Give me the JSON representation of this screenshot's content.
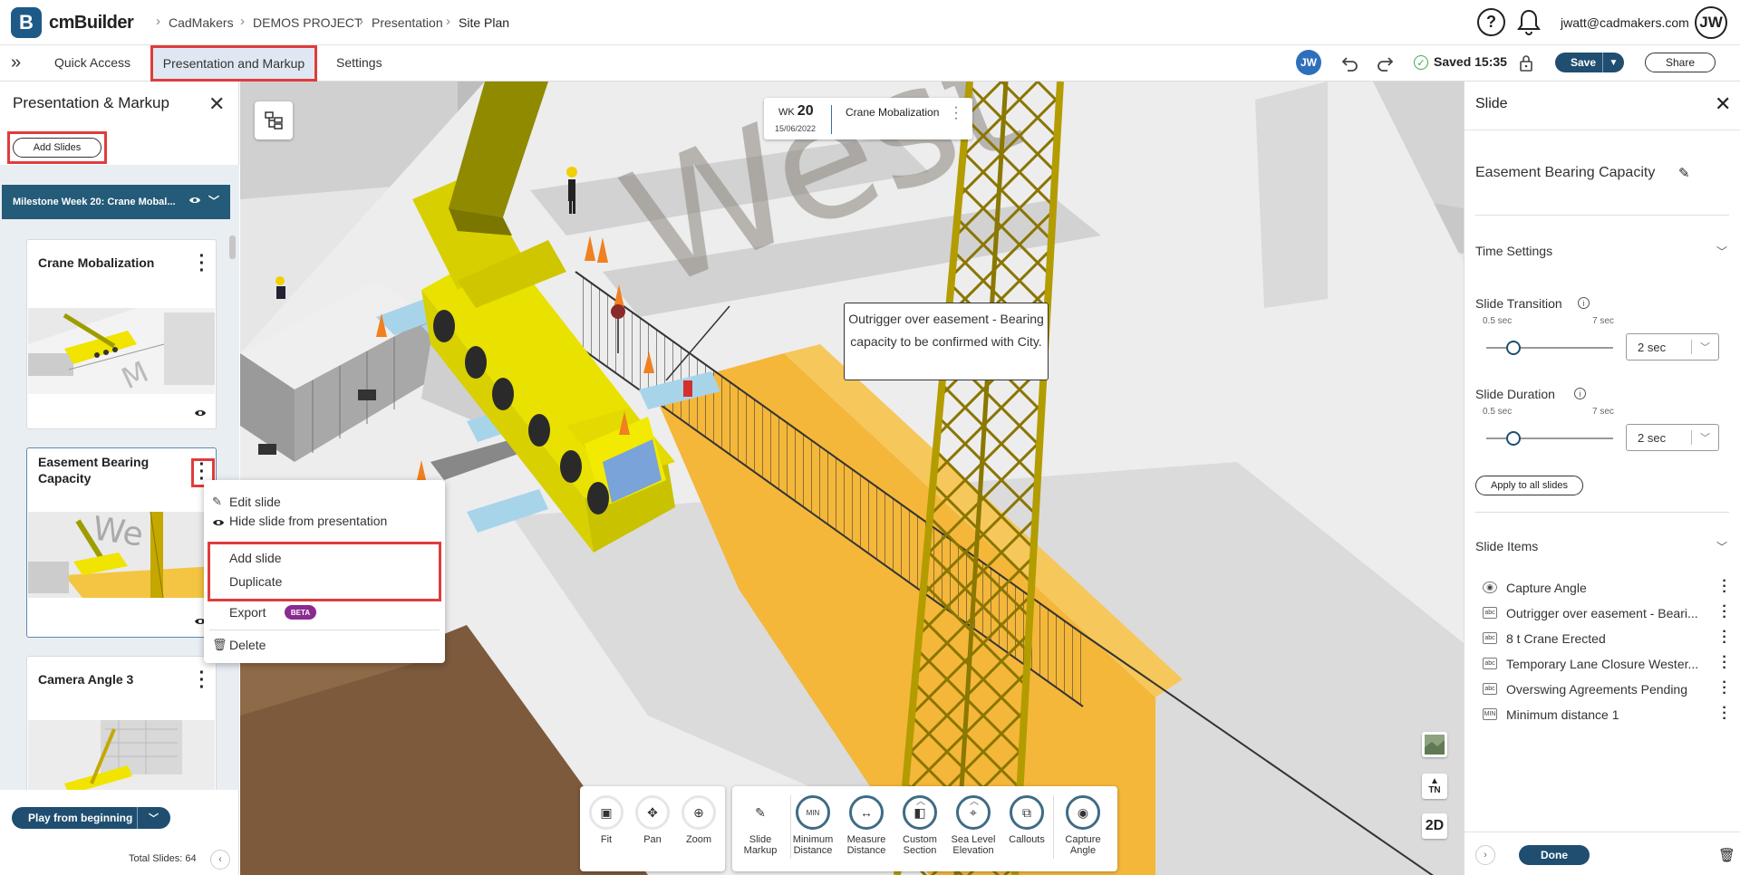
{
  "app": {
    "brand": "cmBuilder",
    "logo_letter": "B"
  },
  "breadcrumb": [
    "CadMakers",
    "DEMOS PROJECT",
    "Presentation",
    "Site Plan"
  ],
  "header": {
    "help_glyph": "?",
    "user_email": "jwatt@cadmakers.com",
    "avatar_initials": "JW"
  },
  "subnav": {
    "tabs": [
      "Quick Access",
      "Presentation and Markup",
      "Settings"
    ],
    "active_tab": "Presentation and Markup",
    "collaborator_initials": "JW",
    "saved_text": "Saved 15:35",
    "save_label": "Save",
    "share_label": "Share"
  },
  "left_panel": {
    "title": "Presentation & Markup",
    "add_slides_label": "Add Slides",
    "milestone_label": "Milestone Week 20: Crane Mobal...",
    "slides": [
      {
        "title": "Crane Mobalization"
      },
      {
        "title": "Easement Bearing Capacity"
      },
      {
        "title": "Camera Angle 3"
      }
    ],
    "play_label": "Play from beginning",
    "total_slides": "Total Slides: 64"
  },
  "context_menu": {
    "items": [
      "Edit slide",
      "Hide slide from presentation",
      "Add slide",
      "Duplicate",
      "Export",
      "Delete"
    ],
    "beta_label": "BETA"
  },
  "viewport": {
    "week_prefix": "WK",
    "week_number": "20",
    "date": "15/06/2022",
    "milestone_name": "Crane Mobalization",
    "callout_text": "Outrigger over easement - Bearing capacity to be confirmed with City.",
    "north_label": "TN",
    "view_mode_label": "2D"
  },
  "toolbar": {
    "nav_tools": [
      "Fit",
      "Pan",
      "Zoom"
    ],
    "markup_tools": [
      {
        "label": "Slide Markup",
        "icon": "pencil-icon"
      },
      {
        "label": "Minimum Distance",
        "icon": "min-distance-icon"
      },
      {
        "label": "Measure Distance",
        "icon": "measure-icon"
      },
      {
        "label": "Custom Section",
        "icon": "section-cube-icon"
      },
      {
        "label": "Sea Level Elevation",
        "icon": "sea-level-icon"
      },
      {
        "label": "Callouts",
        "icon": "callout-icon"
      },
      {
        "label": "Capture Angle",
        "icon": "camera-icon"
      }
    ]
  },
  "right_panel": {
    "title": "Slide",
    "slide_name": "Easement Bearing Capacity",
    "time_settings_label": "Time Settings",
    "transition": {
      "label": "Slide Transition",
      "min": "0.5 sec",
      "max": "7 sec",
      "value": "2 sec"
    },
    "duration": {
      "label": "Slide Duration",
      "min": "0.5 sec",
      "max": "7 sec",
      "value": "2 sec"
    },
    "apply_all_label": "Apply to all slides",
    "slide_items_label": "Slide Items",
    "slide_items": [
      {
        "icon": "camera",
        "label": "Capture Angle"
      },
      {
        "icon": "abc",
        "label": "Outrigger over easement - Beari..."
      },
      {
        "icon": "abc",
        "label": "8 t Crane Erected"
      },
      {
        "icon": "abc",
        "label": "Temporary Lane Closure Wester..."
      },
      {
        "icon": "abc",
        "label": "Overswing Agreements Pending"
      },
      {
        "icon": "MIN",
        "label": "Minimum distance 1"
      }
    ],
    "done_label": "Done"
  },
  "colors": {
    "primary": "#1f4e70",
    "highlight": "#e03c3c",
    "beta": "#8a2b8f",
    "crane": "#f2e600",
    "tower": "#b8a100"
  }
}
